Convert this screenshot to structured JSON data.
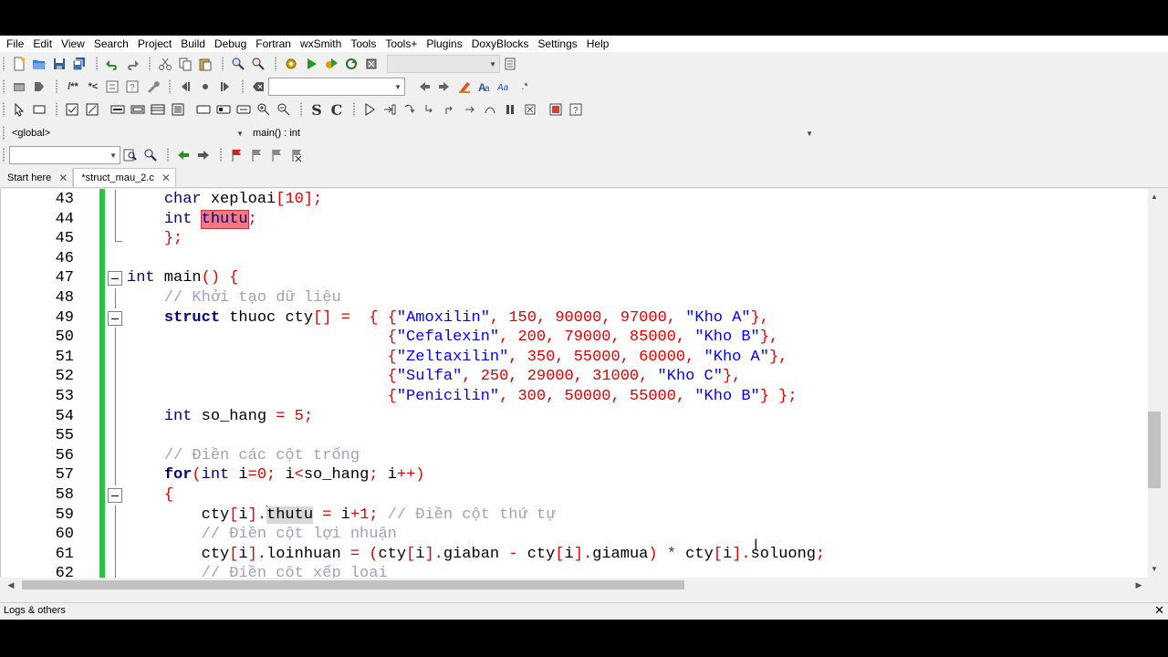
{
  "menu": [
    "File",
    "Edit",
    "View",
    "Search",
    "Project",
    "Build",
    "Debug",
    "Fortran",
    "wxSmith",
    "Tools",
    "Tools+",
    "Plugins",
    "DoxyBlocks",
    "Settings",
    "Help"
  ],
  "toolbar": {
    "build_target_value": "",
    "search_combo_value": "",
    "symbol_search_value": "",
    "regex_label": ".*",
    "comment_label": "/**",
    "uncomment_label": "*<",
    "strip_s": "S",
    "strip_c": "C"
  },
  "code_completion": {
    "scope": "<global>",
    "function": "main() : int"
  },
  "tabs": [
    {
      "label": "Start here",
      "active": false
    },
    {
      "label": "*struct_mau_2.c",
      "active": true
    }
  ],
  "editor": {
    "lines": [
      {
        "no": "43",
        "html": "    <span class='ty'>char</span> xeploai<span class='op'>[</span><span class='num'>10</span><span class='op'>];</span>"
      },
      {
        "no": "44",
        "html": "    <span class='ty'>int</span> <span class='hl-red'>thutu</span><span class='op'>;</span>"
      },
      {
        "no": "45",
        "html": "    <span class='op'>};</span>"
      },
      {
        "no": "46",
        "html": ""
      },
      {
        "no": "47",
        "html": "<span class='ty'>int</span> main<span class='op'>()</span> <span class='op'>{</span>"
      },
      {
        "no": "48",
        "html": "    <span class='cm'>// Khởi tạo dữ liệu</span>"
      },
      {
        "no": "49",
        "html": "    <span class='kw'>struct</span> thuoc cty<span class='op'>[]</span> <span class='op'>=</span>  <span class='op'>{</span> <span class='op'>{</span><span class='str'>\"Amoxilin\"</span><span class='op'>,</span> <span class='num'>150</span><span class='op'>,</span> <span class='num'>90000</span><span class='op'>,</span> <span class='num'>97000</span><span class='op'>,</span> <span class='str'>\"Kho A\"</span><span class='op'>},</span>"
      },
      {
        "no": "50",
        "html": "                            <span class='op'>{</span><span class='str'>\"Cefalexin\"</span><span class='op'>,</span> <span class='num'>200</span><span class='op'>,</span> <span class='num'>79000</span><span class='op'>,</span> <span class='num'>85000</span><span class='op'>,</span> <span class='str'>\"Kho B\"</span><span class='op'>},</span>"
      },
      {
        "no": "51",
        "html": "                            <span class='op'>{</span><span class='str'>\"Zeltaxilin\"</span><span class='op'>,</span> <span class='num'>350</span><span class='op'>,</span> <span class='num'>55000</span><span class='op'>,</span> <span class='num'>60000</span><span class='op'>,</span> <span class='str'>\"Kho A\"</span><span class='op'>},</span>"
      },
      {
        "no": "52",
        "html": "                            <span class='op'>{</span><span class='str'>\"Sulfa\"</span><span class='op'>,</span> <span class='num'>250</span><span class='op'>,</span> <span class='num'>29000</span><span class='op'>,</span> <span class='num'>31000</span><span class='op'>,</span> <span class='str'>\"Kho C\"</span><span class='op'>},</span>"
      },
      {
        "no": "53",
        "html": "                            <span class='op'>{</span><span class='str'>\"Penicilin\"</span><span class='op'>,</span> <span class='num'>300</span><span class='op'>,</span> <span class='num'>50000</span><span class='op'>,</span> <span class='num'>55000</span><span class='op'>,</span> <span class='str'>\"Kho B\"</span><span class='op'>}</span> <span class='op'>};</span>"
      },
      {
        "no": "54",
        "html": "    <span class='ty'>int</span> so_hang <span class='op'>=</span> <span class='num'>5</span><span class='op'>;</span>"
      },
      {
        "no": "55",
        "html": ""
      },
      {
        "no": "56",
        "html": "    <span class='cm'>// Điền các cột trống</span>"
      },
      {
        "no": "57",
        "html": "    <span class='kw'>for</span><span class='op'>(</span><span class='ty'>int</span> i<span class='op'>=</span><span class='num'>0</span><span class='op'>;</span> i<span class='op'>&lt;</span>so_hang<span class='op'>;</span> i<span class='op'>++)</span>"
      },
      {
        "no": "58",
        "html": "    <span class='op'>{</span>"
      },
      {
        "no": "59",
        "html": "        cty<span class='op'>[</span>i<span class='op'>].</span><span class='caret'></span><span class='hl-gray'>thutu</span> <span class='op'>=</span> i<span class='op'>+</span><span class='num'>1</span><span class='op'>;</span> <span class='cm'>// Điền cột thứ tự</span>"
      },
      {
        "no": "60",
        "html": "        <span class='cm'>// Điền cột lợi nhuận</span>"
      },
      {
        "no": "61",
        "html": "        cty<span class='op'>[</span>i<span class='op'>].</span>loinhuan <span class='op'>=</span> <span class='op'>(</span>cty<span class='op'>[</span>i<span class='op'>].</span>giaban <span class='op'>-</span> cty<span class='op'>[</span>i<span class='op'>].</span>giamua<span class='op'>)</span> <span class='op'>*</span> cty<span class='op'>[</span>i<span class='op'>].</span>soluong<span class='op'>;</span>"
      },
      {
        "no": "62",
        "html": "        <span class='cm'>// Điền cột xếp loại</span>"
      }
    ]
  },
  "bottom_panel": {
    "label": "Logs & others",
    "close": "✕"
  },
  "icons": {
    "tab_close": "✕",
    "combo_arrow": "▼",
    "scroll_up": "▲",
    "scroll_down": "▼",
    "scroll_left": "◀",
    "scroll_right": "▶",
    "mouse": "I"
  }
}
